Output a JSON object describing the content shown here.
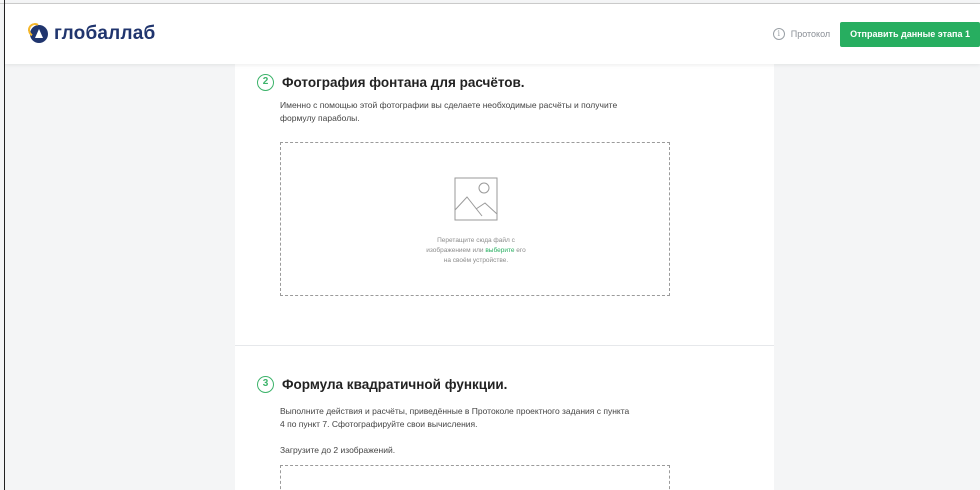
{
  "header": {
    "logo_text": "глобаллаб",
    "protocol_label": "Протокол",
    "submit_label": "Отправить данные этапа 1"
  },
  "sections": [
    {
      "number": "2",
      "title": "Фотография фонтана для расчётов.",
      "description_line1": "Именно с помощью этой фотографии вы сделаете необходимые расчёты и получите",
      "description_line2": "формулу параболы.",
      "dropzone": {
        "text_line1": "Перетащите сюда файл с",
        "text_line2_before": "изображением или ",
        "text_link": "выберите",
        "text_line2_after": " его",
        "text_line3": "на своём устройстве."
      }
    },
    {
      "number": "3",
      "title": "Формула квадратичной функции.",
      "description_line1": "Выполните действия и расчёты, приведённые в Протоколе проектного задания с пункта",
      "description_line2": "4 по пункт 7. Сфотографируйте свои вычисления.",
      "upload_hint": "Загрузите до 2 изображений."
    }
  ],
  "colors": {
    "accent_green": "#27ae60",
    "brand_navy": "#20356e",
    "brand_yellow": "#f5b72b"
  },
  "icons": [
    "logo-mark-icon",
    "info-icon",
    "image-placeholder-icon"
  ]
}
